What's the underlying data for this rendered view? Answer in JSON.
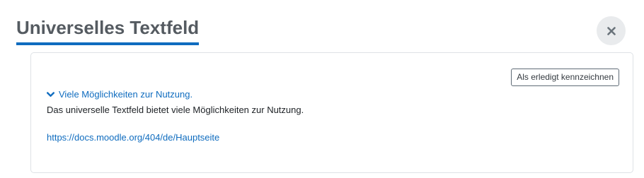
{
  "header": {
    "title": "Universelles Textfeld"
  },
  "close_button": {
    "icon": "close-icon"
  },
  "activity": {
    "mark_done_label": "Als erledigt kennzeichnen",
    "toggle_icon": "chevron-down-icon",
    "toggle_label": "Viele Möglichkeiten zur Nutzung.",
    "description": "Das universelle Textfeld bietet viele Möglichkeiten zur Nutzung.",
    "link_text": "https://docs.moodle.org/404/de/Hauptseite"
  },
  "colors": {
    "accent": "#0f6cbf",
    "title_text": "#555b61",
    "close_bg": "#e9ebed",
    "card_border": "#dee2e6"
  }
}
